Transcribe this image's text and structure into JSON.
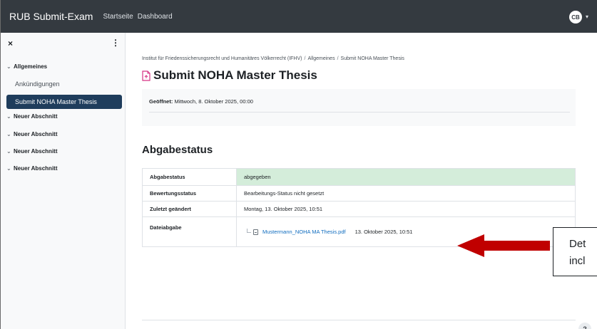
{
  "navbar": {
    "brand": "RUB Submit-Exam",
    "links": [
      "Startseite",
      "Dashboard"
    ],
    "avatar_initials": "CB"
  },
  "drawer": {
    "close_icon": "close-icon",
    "menu_icon": "kebab-icon",
    "sections": [
      {
        "title": "Allgemeines",
        "expanded": true
      },
      {
        "title": "Neuer Abschnitt",
        "expanded": false
      },
      {
        "title": "Neuer Abschnitt",
        "expanded": false
      },
      {
        "title": "Neuer Abschnitt",
        "expanded": false
      },
      {
        "title": "Neuer Abschnitt",
        "expanded": false
      }
    ],
    "items": [
      "Ankündigungen",
      "Submit NOHA Master Thesis"
    ],
    "active_item": "Submit NOHA Master Thesis"
  },
  "breadcrumb": {
    "items": [
      "Institut für Friedenssicherungsrecht und Humanitäres Völkerrecht (IFHV)",
      "Allgemeines",
      "Submit NOHA Master Thesis"
    ],
    "separator": "/"
  },
  "page": {
    "title": "Submit NOHA Master Thesis",
    "icon": "assignment-icon",
    "opened_label": "Geöffnet:",
    "opened_value": "Mittwoch, 8. Oktober 2025, 00:00"
  },
  "submission": {
    "heading": "Abgabestatus",
    "rows": [
      {
        "label": "Abgabestatus",
        "value": "abgegeben"
      },
      {
        "label": "Bewertungsstatus",
        "value": "Bearbeitungs-Status nicht gesetzt"
      },
      {
        "label": "Zuletzt geändert",
        "value": "Montag, 13. Oktober 2025, 10:51"
      },
      {
        "label": "Dateiabgabe",
        "value": ""
      }
    ],
    "file": {
      "name": "Mustermann_NOHA MA Thesis.pdf",
      "date": "13. Oktober 2025, 10:51",
      "icon": "pdf-file-icon"
    }
  },
  "help_button": "?",
  "annotation": {
    "line1": "Det",
    "line2": "incl",
    "arrow_color": "#c00000"
  },
  "colors": {
    "navbar": "#343a40",
    "active_item": "#1f3d5c",
    "status_ok": "#d4edda",
    "link": "#0f6cbf"
  }
}
